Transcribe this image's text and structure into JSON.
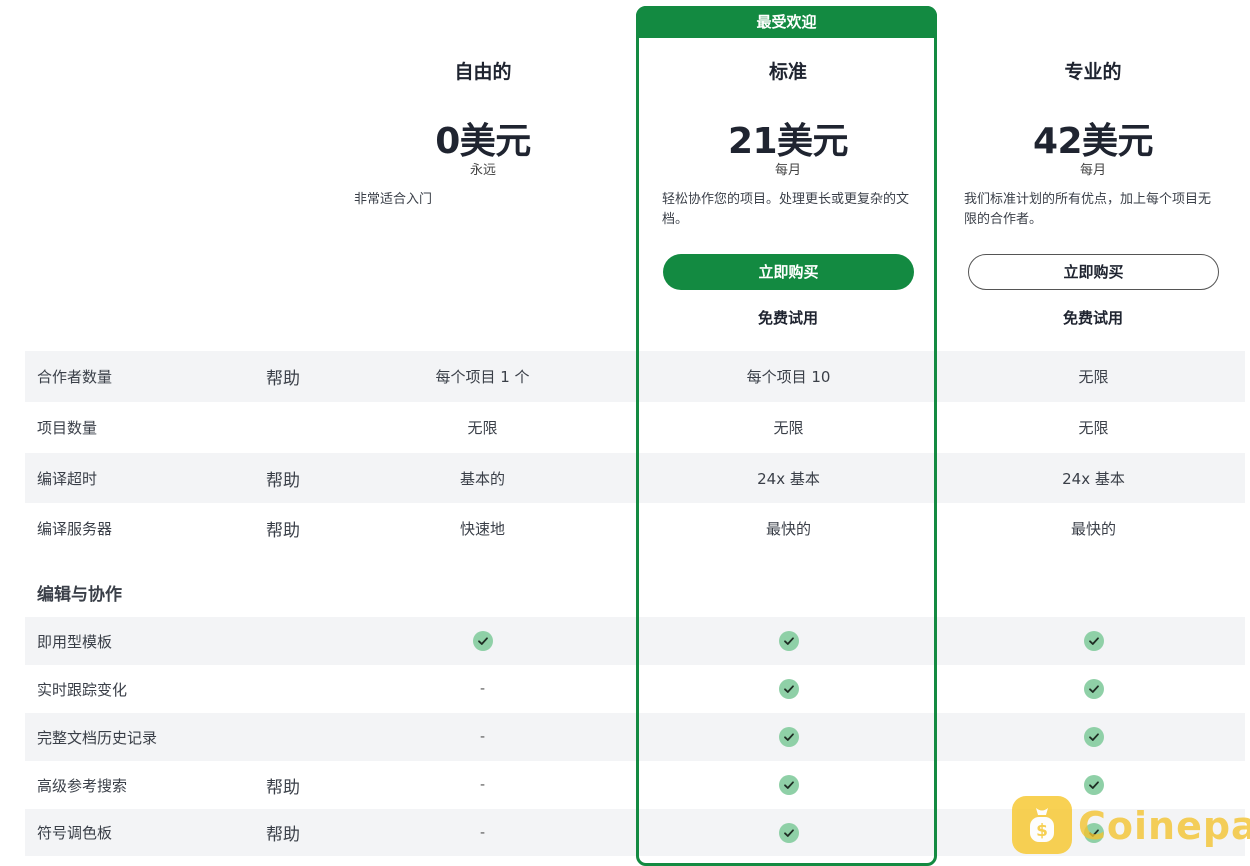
{
  "badge": "最受欢迎",
  "plans": [
    {
      "name": "自由的",
      "price": "0美元",
      "period": "永远",
      "desc": "非常适合入门"
    },
    {
      "name": "标准",
      "price": "21美元",
      "period": "每月",
      "desc": "轻松协作您的项目。处理更长或更复杂的文档。",
      "buy": "立即购买",
      "trial": "免费试用"
    },
    {
      "name": "专业的",
      "price": "42美元",
      "period": "每月",
      "desc": "我们标准计划的所有优点，加上每个项目无限的合作者。",
      "buy": "立即购买",
      "trial": "免费试用"
    }
  ],
  "features": [
    {
      "label": "合作者数量",
      "help": "帮助",
      "values": [
        "每个项目 1 个",
        "每个项目 10",
        "无限"
      ]
    },
    {
      "label": "项目数量",
      "help": "",
      "values": [
        "无限",
        "无限",
        "无限"
      ]
    },
    {
      "label": "编译超时",
      "help": "帮助",
      "values": [
        "基本的",
        "24x 基本",
        "24x 基本"
      ]
    },
    {
      "label": "编译服务器",
      "help": "帮助",
      "values": [
        "快速地",
        "最快的",
        "最快的"
      ]
    }
  ],
  "section_title": "编辑与协作",
  "collab_features": [
    {
      "label": "即用型模板",
      "help": "",
      "values": [
        "check",
        "check",
        "check"
      ]
    },
    {
      "label": "实时跟踪变化",
      "help": "",
      "values": [
        "-",
        "check",
        "check"
      ]
    },
    {
      "label": "完整文档历史记录",
      "help": "",
      "values": [
        "-",
        "check",
        "check"
      ]
    },
    {
      "label": "高级参考搜索",
      "help": "帮助",
      "values": [
        "-",
        "check",
        "check"
      ]
    },
    {
      "label": "符号调色板",
      "help": "帮助",
      "values": [
        "-",
        "check",
        "check"
      ]
    }
  ],
  "watermark": {
    "text": "Coinepay",
    "color": "#f3c431"
  },
  "colors": {
    "accent": "#138a41",
    "check_bg": "#8fd0a7",
    "row_gray": "#f3f4f6"
  }
}
